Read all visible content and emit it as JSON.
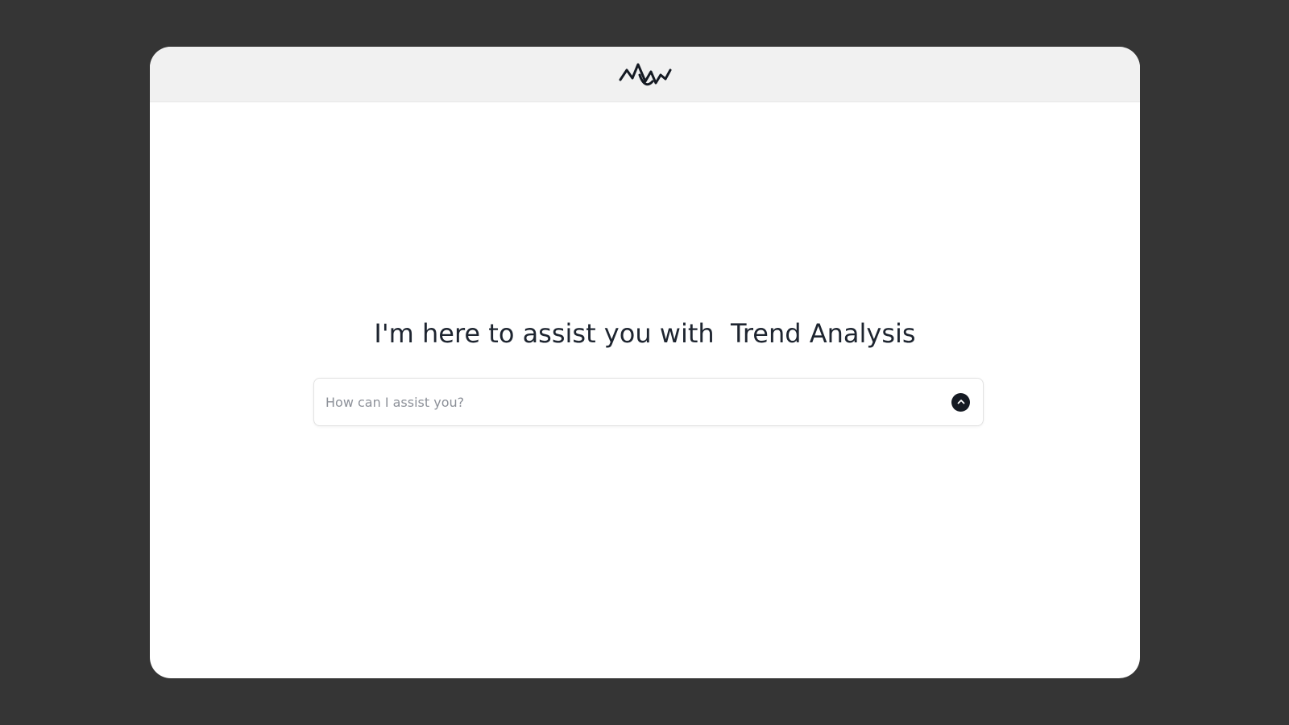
{
  "header": {
    "logo_icon": "wave-logo-icon"
  },
  "hero": {
    "lead_text": "I'm here to assist you with ",
    "topic_text": " Trend Analysis"
  },
  "prompt": {
    "placeholder": "How can I assist you?",
    "value": "",
    "send_icon": "chevron-up-icon"
  },
  "colors": {
    "backdrop": "#353535",
    "header_bg": "#f1f1f1",
    "card_bg": "#ffffff",
    "text_primary": "#1e2530",
    "placeholder": "#8d9199",
    "send_button_bg": "#151a23"
  }
}
